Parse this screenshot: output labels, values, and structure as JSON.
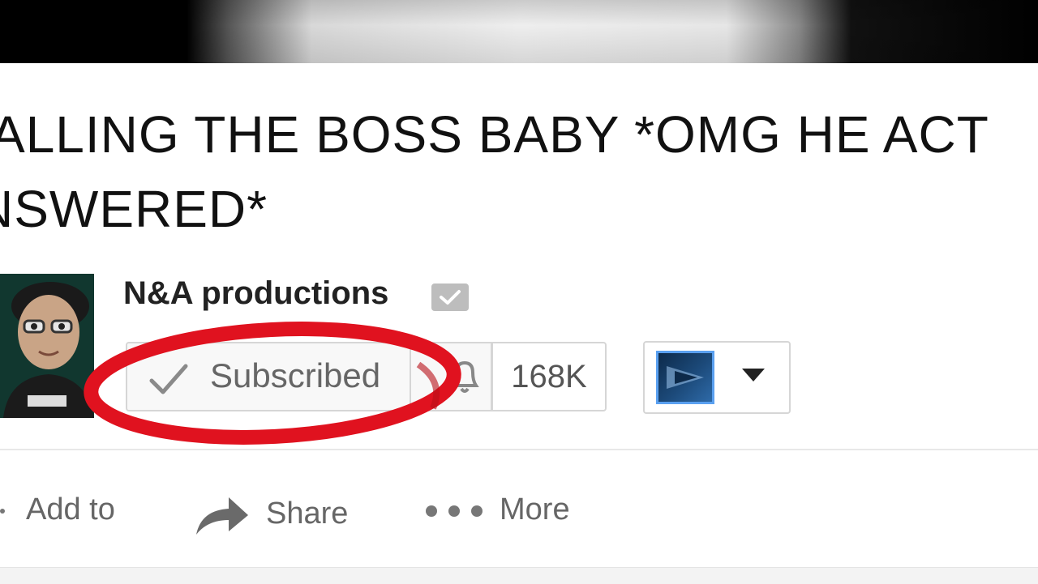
{
  "video": {
    "title_line1": "ALLING THE BOSS BABY *OMG HE ACT",
    "title_line2": "NSWERED*"
  },
  "channel": {
    "name": "N&A productions",
    "avatar_icon": "person-avatar-icon",
    "verified_icon": "verified-check-icon"
  },
  "subscribe": {
    "label": "Subscribed",
    "check_icon": "checkmark-icon",
    "bell_icon": "notification-bell-icon",
    "subscriber_count": "168K"
  },
  "account": {
    "thumb_icon": "channel-thumbnail-icon",
    "menu_icon": "dropdown-caret-icon"
  },
  "actions": [
    {
      "label": "Add to",
      "icon": "add-to-playlist-icon"
    },
    {
      "label": "Share",
      "icon": "share-arrow-icon"
    },
    {
      "label": "More",
      "icon": "more-dots-icon"
    }
  ],
  "highlight_color": "#e0121f",
  "colors": {
    "accent_blue": "#5aa0f0"
  }
}
